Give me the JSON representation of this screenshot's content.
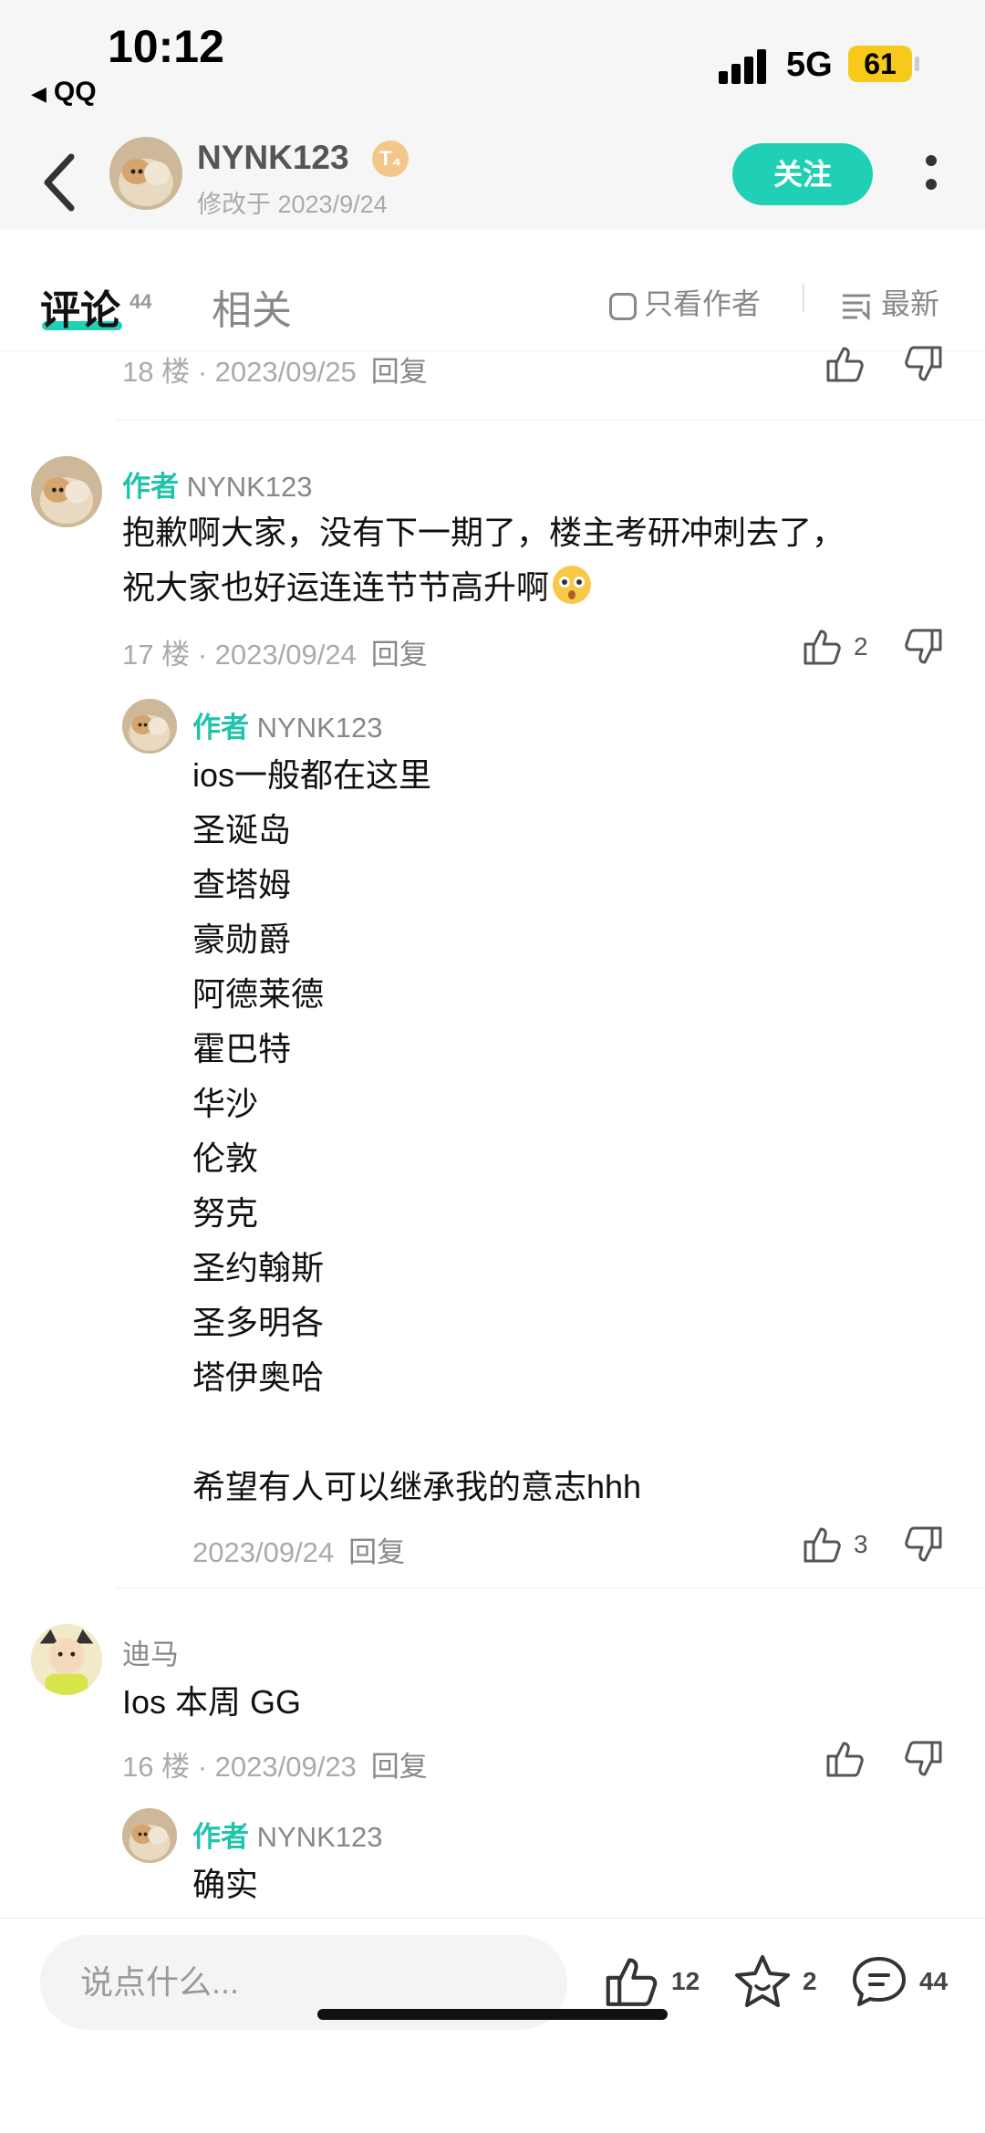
{
  "status_bar": {
    "time": "10:12",
    "back_app": "QQ",
    "network": "5G",
    "battery": "61"
  },
  "header": {
    "author_name": "NYNK123",
    "level_badge": "T₄",
    "modified": "修改于 2023/9/24",
    "follow_label": "关注"
  },
  "tabs": {
    "comments_label": "评论",
    "comments_count": "44",
    "related_label": "相关",
    "only_author_label": "只看作者",
    "sort_label": "最新"
  },
  "comments": {
    "c18": {
      "meta": "18 楼 · 2023/09/25",
      "reply": "回复"
    },
    "c17": {
      "author_tag": "作者",
      "name": "NYNK123",
      "text": "抱歉啊大家，没有下一期了，楼主考研冲刺去了，\n祝大家也好运连连节节高升啊",
      "meta": "17 楼 · 2023/09/24",
      "reply": "回复",
      "likes": "2",
      "sub": {
        "author_tag": "作者",
        "name": "NYNK123",
        "text": "ios一般都在这里\n圣诞岛\n查塔姆\n豪勋爵\n阿德莱德\n霍巴特\n华沙\n伦敦\n努克\n圣约翰斯\n圣多明各\n塔伊奥哈\n\n希望有人可以继承我的意志hhh",
        "meta": "2023/09/24",
        "reply": "回复",
        "likes": "3"
      }
    },
    "c16": {
      "name": "迪马",
      "text": "Ios 本周 GG",
      "meta": "16 楼 · 2023/09/23",
      "reply": "回复",
      "sub": {
        "author_tag": "作者",
        "name": "NYNK123",
        "text": "确实"
      }
    }
  },
  "bottom_bar": {
    "input_placeholder": "说点什么...",
    "likes": "12",
    "favorites": "2",
    "comments": "44"
  },
  "colors": {
    "accent": "#1fd0b5",
    "badge": "#f3c68a",
    "battery": "#f6c91a"
  },
  "icons": [
    "back-chevron-icon",
    "more-icon",
    "checkbox-icon",
    "sort-icon",
    "thumb-up-icon",
    "thumb-down-icon",
    "star-icon",
    "comment-icon",
    "emoji-icon"
  ]
}
